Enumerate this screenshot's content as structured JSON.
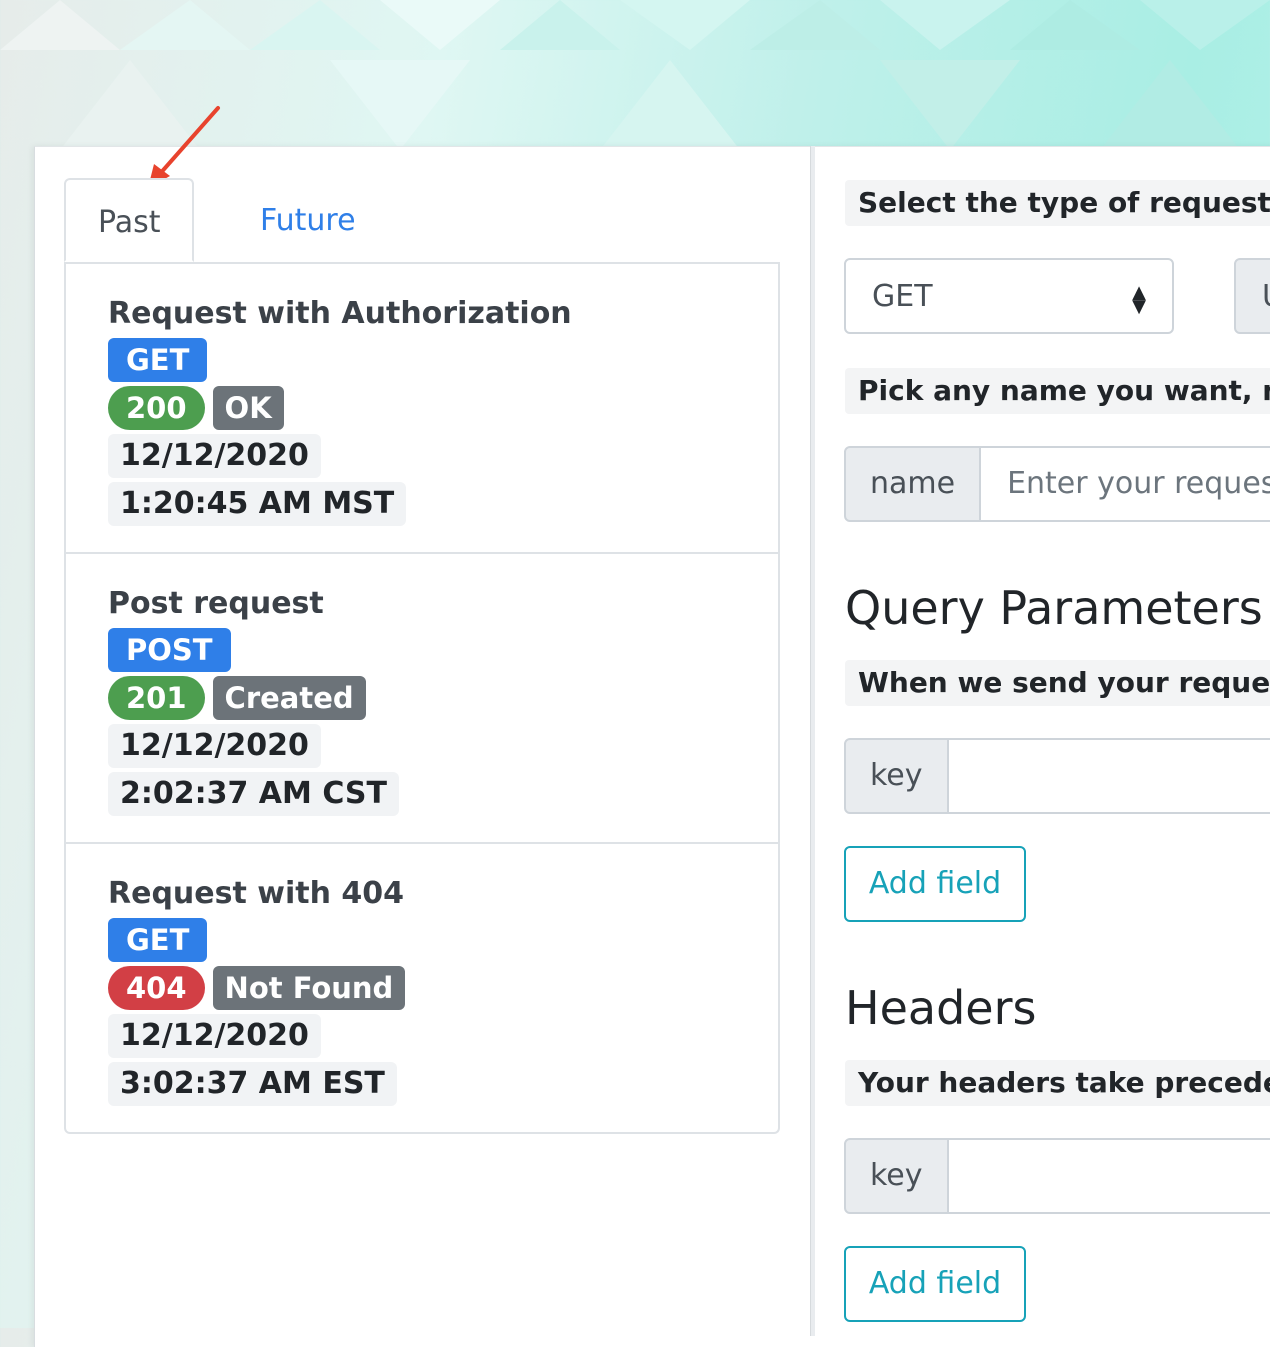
{
  "tabs": {
    "past": "Past",
    "future": "Future"
  },
  "requests": [
    {
      "title": "Request with Authorization",
      "method": "GET",
      "status_code": "200",
      "status_text": "OK",
      "status_kind": "ok",
      "date": "12/12/2020",
      "time": "1:20:45 AM MST"
    },
    {
      "title": "Post request",
      "method": "POST",
      "status_code": "201",
      "status_text": "Created",
      "status_kind": "ok",
      "date": "12/12/2020",
      "time": "2:02:37 AM CST"
    },
    {
      "title": "Request with 404",
      "method": "GET",
      "status_code": "404",
      "status_text": "Not Found",
      "status_kind": "error",
      "date": "12/12/2020",
      "time": "3:02:37 AM EST"
    }
  ],
  "form": {
    "type_hint": "Select the type of request to",
    "method_value": "GET",
    "side_button_partial": "U",
    "name_hint": "Pick any name you want, ma",
    "name_label": "name",
    "name_placeholder": "Enter your request",
    "query_heading": "Query Parameters",
    "query_hint": "When we send your request,",
    "query_key_label": "key",
    "query_add_label": "Add field",
    "headers_heading": "Headers",
    "headers_hint": "Your headers take preceden",
    "headers_key_label": "key",
    "headers_add_label": "Add field"
  },
  "colors": {
    "primary": "#2f7fe8",
    "success": "#4d9e4f",
    "danger": "#d23f45",
    "secondary": "#6c7379",
    "info": "#17a2b8",
    "annotation_arrow": "#e8432d"
  }
}
